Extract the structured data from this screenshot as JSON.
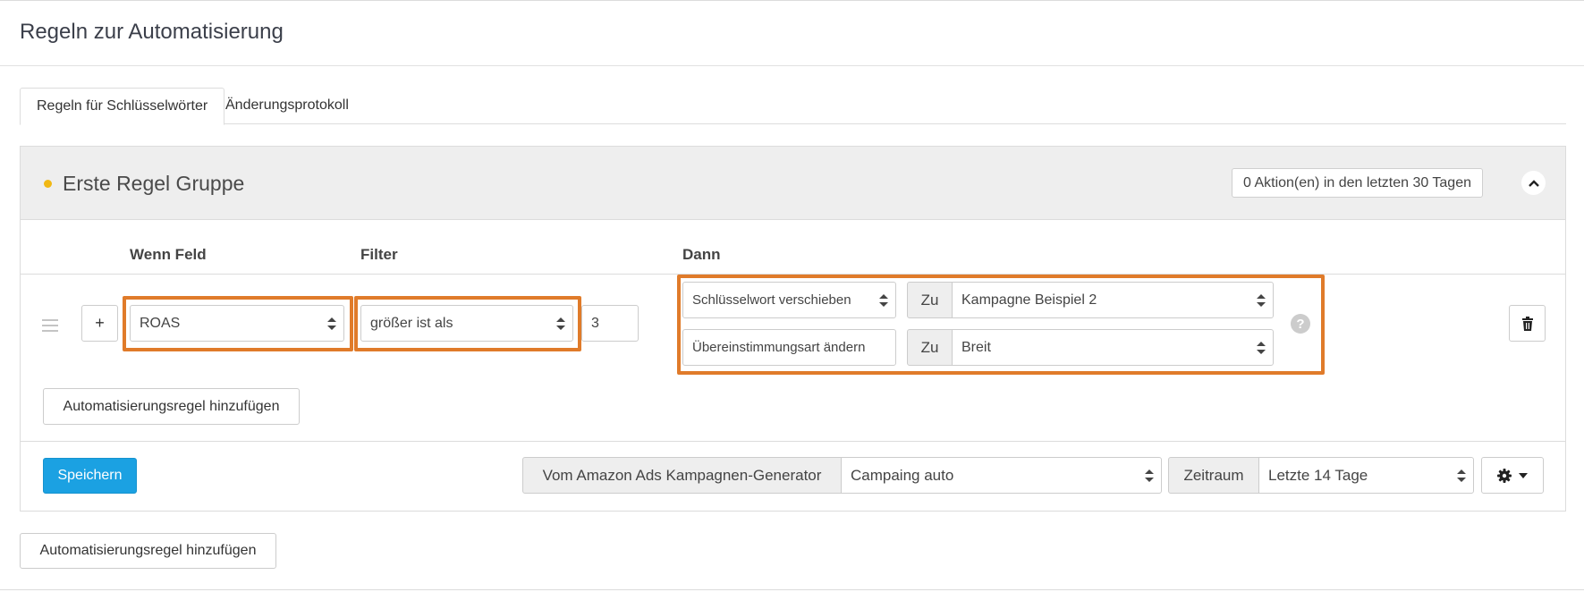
{
  "page": {
    "title": "Regeln zur Automatisierung"
  },
  "tabs": [
    {
      "label": "Regeln für Schlüsselwörter",
      "active": true
    },
    {
      "label": "Änderungsprotokoll",
      "active": false
    }
  ],
  "group": {
    "title": "Erste Regel Gruppe",
    "actions_count": "0 Aktion(en) in den letzten 30 Tagen",
    "dot_color": "#f1b814"
  },
  "columns": {
    "if_field": "Wenn Feld",
    "filter": "Filter",
    "then": "Dann"
  },
  "rule": {
    "add_condition_label": "+",
    "field": "ROAS",
    "filter": "größer ist als",
    "value": "3",
    "actions": [
      {
        "action": "Schlüsselwort verschieben",
        "to_label": "Zu",
        "target": "Kampagne Beispiel 2"
      },
      {
        "action": "Übereinstimmungsart ändern",
        "to_label": "Zu",
        "target": "Breit"
      }
    ],
    "help": "?"
  },
  "inner_add_rule_label": "Automatisierungsregel hinzufügen",
  "footer": {
    "save_label": "Speichern",
    "generator_label": "Vom Amazon Ads Kampagnen-Generator",
    "generator_value": "Campaing auto",
    "period_label": "Zeitraum",
    "period_value": "Letzte 14 Tage"
  },
  "outer_add_rule_label": "Automatisierungsregel hinzufügen",
  "colors": {
    "highlight": "#e07b2a",
    "primary": "#1ba1e2"
  },
  "icons": [
    "drag-handle-icon",
    "chevron-up-icon",
    "sort-arrows-icon",
    "help-icon",
    "trash-icon",
    "gear-icon",
    "caret-down-icon"
  ]
}
